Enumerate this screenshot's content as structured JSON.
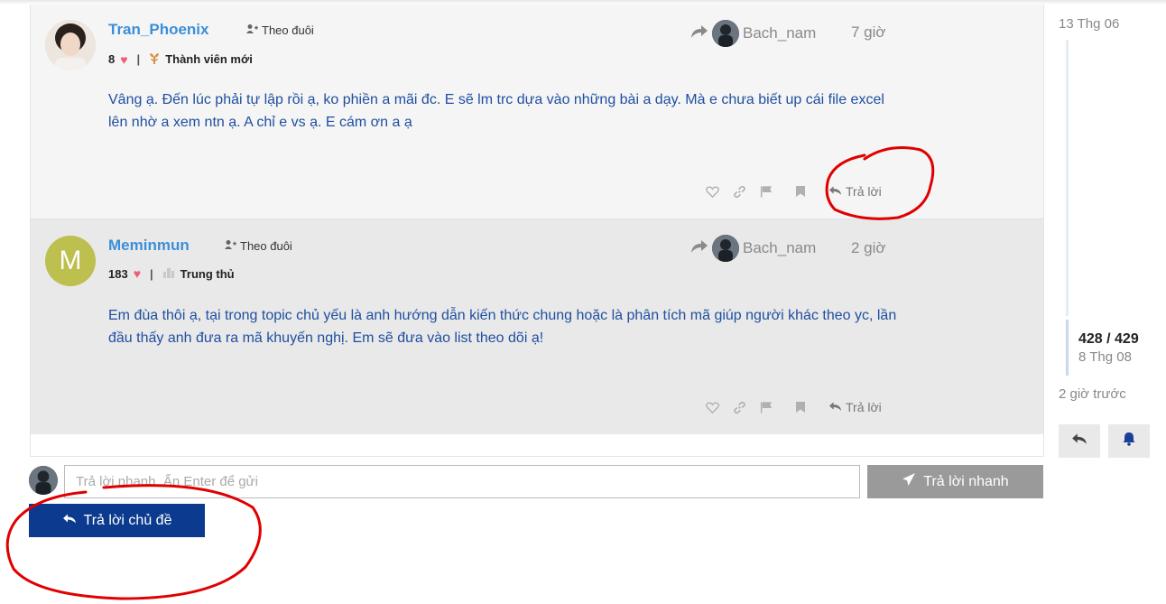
{
  "posts": [
    {
      "username": "Tran_Phoenix",
      "follow_label": "Theo đuôi",
      "likes": "8",
      "rank": "Thành viên mới",
      "reply_to_user": "Bach_nam",
      "time": "7 giờ",
      "body": "Vâng ạ. Đến lúc phải tự lập rồi ạ, ko phiền a mãi đc. E sẽ lm trc dựa vào những bài a dạy. Mà e chưa biết up cái file excel lên nhờ a xem ntn ạ. A chỉ e vs ạ. E cám ơn a ạ",
      "reply_label": "Trả lời"
    },
    {
      "username": "Meminmun",
      "avatar_letter": "M",
      "follow_label": "Theo đuôi",
      "likes": "183",
      "rank": "Trung thủ",
      "reply_to_user": "Bach_nam",
      "time": "2 giờ",
      "body": "Em đùa thôi ạ, tại trong topic chủ yếu là anh hướng dẫn kiến thức chung hoặc là phân tích mã giúp người khác theo yc, lần đầu thấy anh đưa ra mã khuyến nghị. Em sẽ đưa vào list theo dõi ạ!",
      "reply_label": "Trả lời"
    }
  ],
  "timeline": {
    "date_top": "13 Thg 06",
    "count": "428 / 429",
    "date_current": "8 Thg 08",
    "ago": "2 giờ trước"
  },
  "quick_reply": {
    "placeholder": "Trả lời nhanh. Ấn Enter để gửi",
    "button_label": "Trả lời nhanh"
  },
  "reply_topic_label": "Trả lời chủ đề",
  "colors": {
    "username": "#3b8fd8",
    "body_text": "#1f4fa0",
    "reply_topic_button": "#0b3a8e",
    "annotation": "#e00000"
  }
}
